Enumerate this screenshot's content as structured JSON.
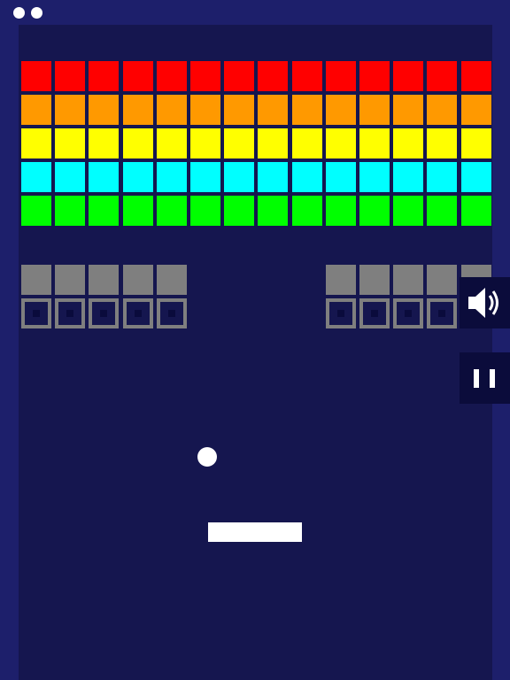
{
  "game": {
    "lives_remaining": 2,
    "colors": {
      "background": "#1d1f6b",
      "playfield": "#15164f",
      "ball": "#ffffff",
      "paddle": "#ffffff",
      "steel_brick": "#7f7f7f"
    },
    "brick_rows": [
      {
        "color": "#ff0000",
        "type": "normal",
        "columns": [
          0,
          1,
          2,
          3,
          4,
          5,
          6,
          7,
          8,
          9,
          10,
          11,
          12,
          13
        ]
      },
      {
        "color": "#ff9900",
        "type": "normal",
        "columns": [
          0,
          1,
          2,
          3,
          4,
          5,
          6,
          7,
          8,
          9,
          10,
          11,
          12,
          13
        ]
      },
      {
        "color": "#ffff00",
        "type": "normal",
        "columns": [
          0,
          1,
          2,
          3,
          4,
          5,
          6,
          7,
          8,
          9,
          10,
          11,
          12,
          13
        ]
      },
      {
        "color": "#00ffff",
        "type": "normal",
        "columns": [
          0,
          1,
          2,
          3,
          4,
          5,
          6,
          7,
          8,
          9,
          10,
          11,
          12,
          13
        ]
      },
      {
        "color": "#00ff00",
        "type": "normal",
        "columns": [
          0,
          1,
          2,
          3,
          4,
          5,
          6,
          7,
          8,
          9,
          10,
          11,
          12,
          13
        ]
      },
      {
        "color": "#7f7f7f",
        "type": "steel",
        "columns": [
          0,
          1,
          2,
          3,
          4,
          9,
          10,
          11,
          12,
          13
        ]
      },
      {
        "color": "#7f7f7f",
        "type": "hollow",
        "columns": [
          0,
          1,
          2,
          3,
          4,
          9,
          10,
          11,
          12,
          13
        ]
      }
    ],
    "buttons": {
      "sound_icon": "speaker-icon",
      "pause_icon": "pause-icon"
    }
  }
}
